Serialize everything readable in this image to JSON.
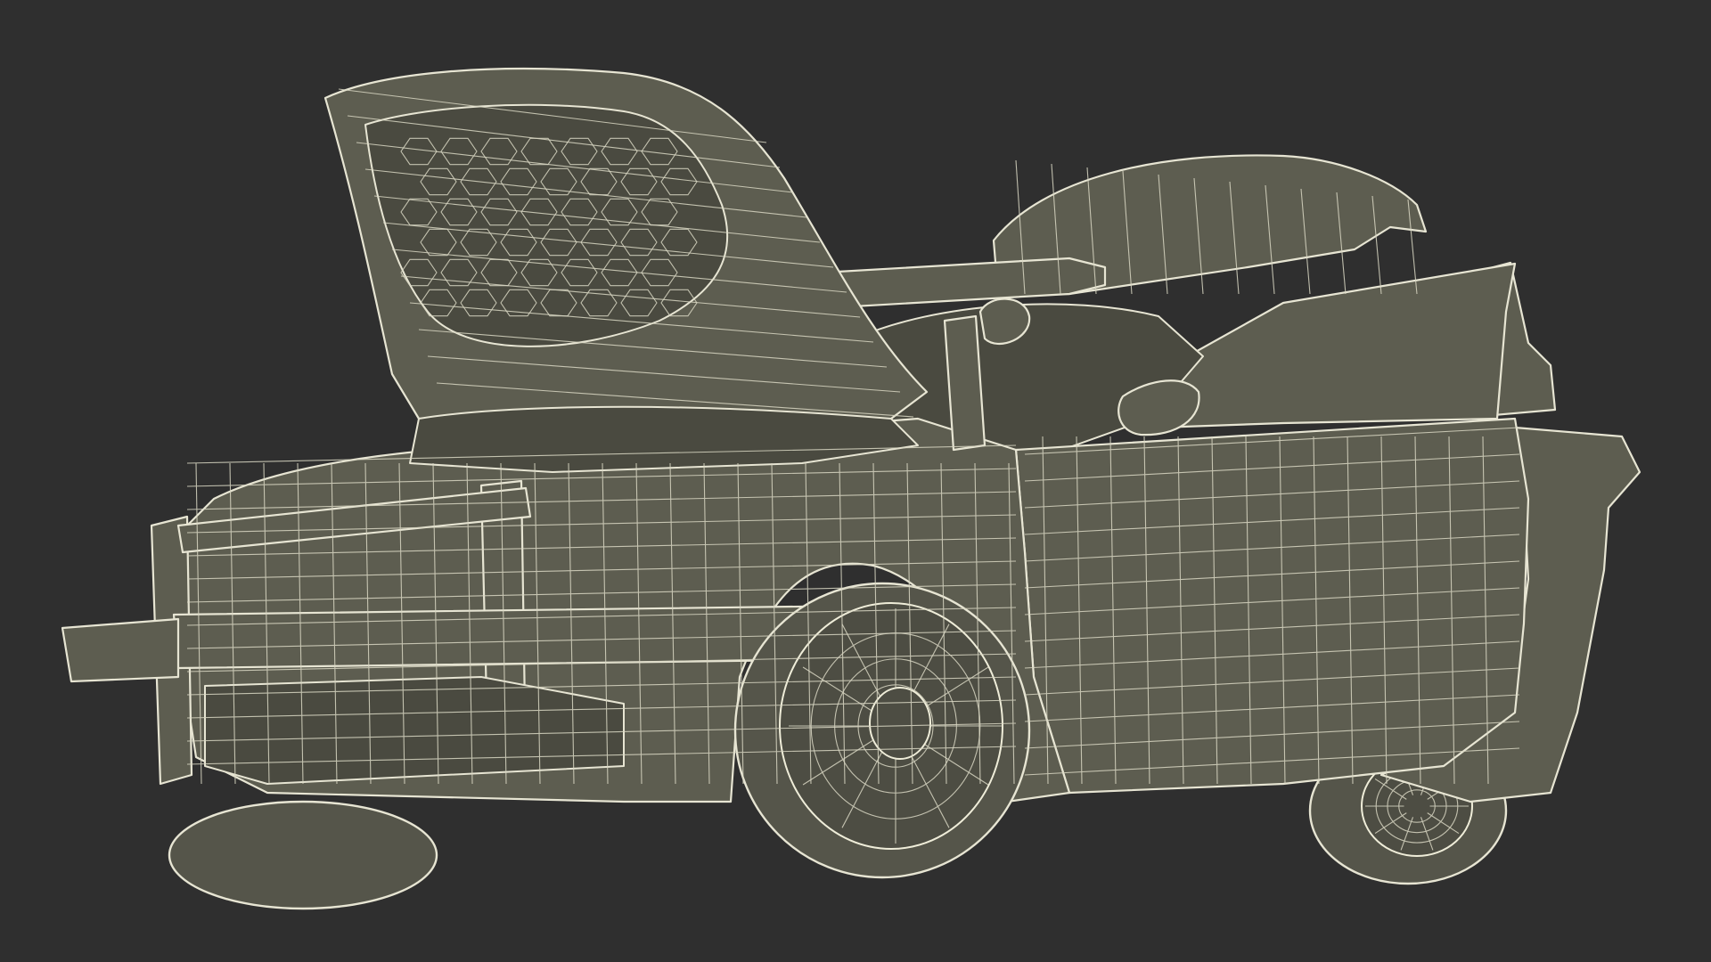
{
  "colors": {
    "background": "#2f2f2f",
    "model_fill": "#5d5d50",
    "wireframe_line": "#e7e5d3"
  },
  "icons": {
    "model": "car-wireframe-icon"
  }
}
